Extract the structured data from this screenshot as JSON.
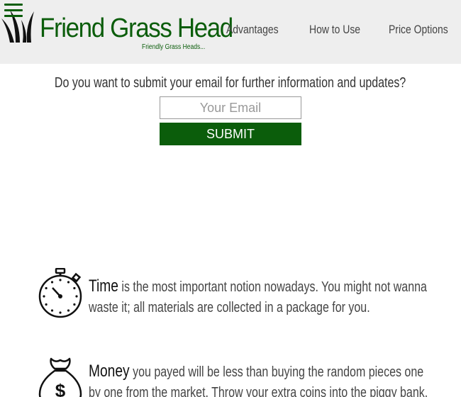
{
  "header": {
    "brand": {
      "title": "Friend Grass Head",
      "tagline": "Friendly Grass Heads..."
    },
    "nav": [
      {
        "label": "Advantages"
      },
      {
        "label": "How to Use"
      },
      {
        "label": "Price Options"
      }
    ]
  },
  "subscribe": {
    "prompt": "Do you want to submit your email for further information and updates?",
    "email_placeholder": "Your Email",
    "email_value": "",
    "submit_label": "SUBMIT"
  },
  "features": [
    {
      "icon": "stopwatch-icon",
      "title": "Time",
      "text": " is the most important notion nowadays. You might not wanna waste it; all materials are collected in a package for you."
    },
    {
      "icon": "money-bag-icon",
      "title": "Money",
      "text": " you payed will be less than buying the random pieces one by one from the market. Throw your extra coins into the piggy bank."
    }
  ],
  "colors": {
    "brand_green": "#0b5d0b",
    "header_bg": "#eeeeee",
    "text": "#444444"
  }
}
